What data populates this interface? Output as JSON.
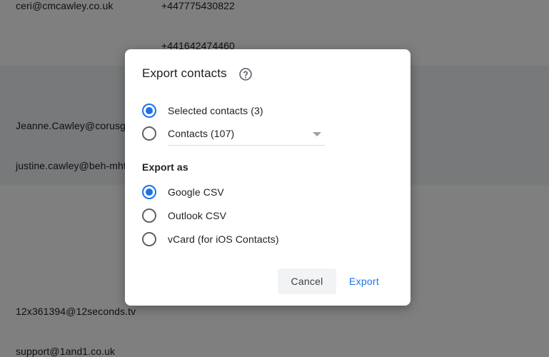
{
  "background": {
    "rows": [
      {
        "email": "ceri@cmcawley.co.uk",
        "phone": "+447775430822"
      },
      {
        "email": "",
        "phone": "+441642474460"
      },
      {
        "email": "Jeanne.Cawley@corusgroup.com",
        "phone": ""
      },
      {
        "email": "justine.cawley@beh-mht.nhs.uk",
        "phone": ""
      },
      {
        "email": "12x361394@12seconds.tv",
        "phone": ""
      },
      {
        "email": "support@1and1.co.uk",
        "phone": ""
      }
    ]
  },
  "dialog": {
    "title": "Export contacts",
    "help_icon": "help-circle-icon",
    "scope_options": [
      {
        "label": "Selected contacts (3)",
        "checked": true
      },
      {
        "label": "Contacts (107)",
        "checked": false
      }
    ],
    "format_heading": "Export as",
    "format_options": [
      {
        "label": "Google CSV",
        "checked": true
      },
      {
        "label": "Outlook CSV",
        "checked": false
      },
      {
        "label": "vCard (for iOS Contacts)",
        "checked": false
      }
    ],
    "cancel_label": "Cancel",
    "export_label": "Export"
  },
  "colors": {
    "accent": "#1a73e8",
    "scrim": "rgba(0,0,0,0.5)"
  }
}
